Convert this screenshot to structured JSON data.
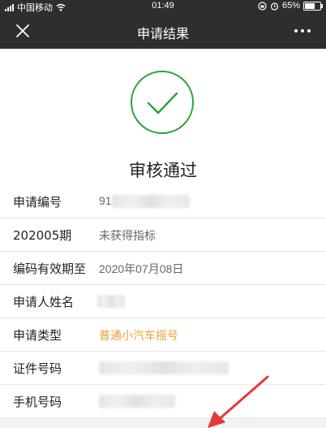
{
  "status_bar": {
    "carrier": "中国移动",
    "time": "01:49",
    "battery_percent": "65%",
    "battery_level": 0.65
  },
  "nav": {
    "title": "申请结果",
    "close_icon": "close-icon",
    "more_icon": "more-icon"
  },
  "result": {
    "icon": "check-circle-icon",
    "icon_color": "#2aa33a",
    "text": "审核通过"
  },
  "rows": [
    {
      "label": "申请编号",
      "value": "91",
      "redacted": true
    },
    {
      "label": "202005期",
      "value": "未获得指标"
    },
    {
      "label": "编码有效期至",
      "value": "2020年07月08日"
    },
    {
      "label": "申请人姓名",
      "value": "",
      "redacted": true
    },
    {
      "label": "申请类型",
      "value": "普通小汽车摇号",
      "accent": true
    },
    {
      "label": "证件号码",
      "value": "",
      "redacted": true
    },
    {
      "label": "手机号码",
      "value": "",
      "redacted": true
    }
  ],
  "colors": {
    "header_bg": "#2e2e2e",
    "accent_value": "#e8a33b",
    "annotation_arrow": "#e53935"
  }
}
